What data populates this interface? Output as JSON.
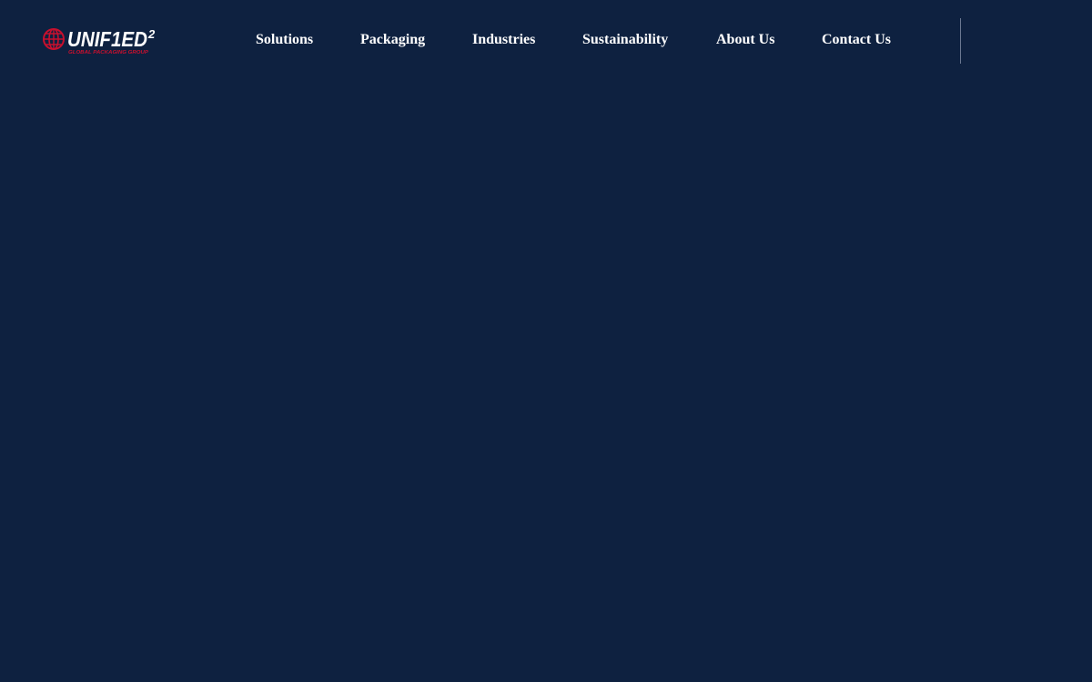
{
  "brand": {
    "wordmark": "UNIF1ED",
    "superscript": "2",
    "tagline": "GLOBAL PACKAGING GROUP",
    "accent_color": "#c8102e",
    "text_color": "#ffffff",
    "background_color": "#0e2140"
  },
  "nav": {
    "items": [
      {
        "label": "Solutions"
      },
      {
        "label": "Packaging"
      },
      {
        "label": "Industries"
      },
      {
        "label": "Sustainability"
      },
      {
        "label": "About Us"
      },
      {
        "label": "Contact Us"
      }
    ]
  }
}
